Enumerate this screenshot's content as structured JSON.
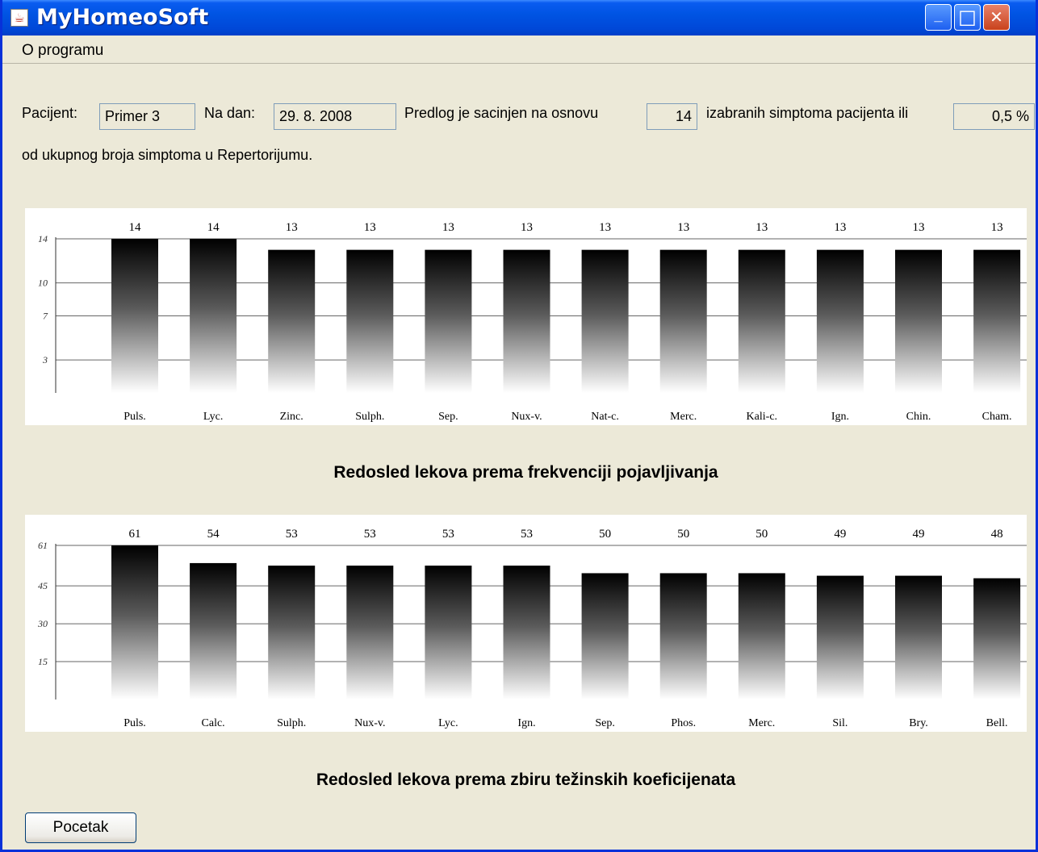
{
  "window": {
    "title": "MyHomeoSoft",
    "minimize_glyph": "_",
    "maximize_glyph": "□",
    "close_glyph": "✕"
  },
  "menu": {
    "items": [
      "O programu"
    ]
  },
  "patient": {
    "patient_label": "Pacijent:",
    "patient_value": "Primer 3",
    "date_label": "Na dan:",
    "date_value": "29. 8. 2008",
    "basis_label": "Predlog je sacinjen na osnovu",
    "symptom_count": "14",
    "selected_label": "izabranih simptoma pacijenta ili",
    "percent_value": "0,5 %",
    "total_label": "od ukupnog broja simptoma u Repertorijumu."
  },
  "chart_data": [
    {
      "type": "bar",
      "title": "Redosled lekova prema frekvenciji pojavljivanja",
      "categories": [
        "Puls.",
        "Lyc.",
        "Zinc.",
        "Sulph.",
        "Sep.",
        "Nux-v.",
        "Nat-c.",
        "Merc.",
        "Kali-c.",
        "Ign.",
        "Chin.",
        "Cham."
      ],
      "values": [
        14,
        14,
        13,
        13,
        13,
        13,
        13,
        13,
        13,
        13,
        13,
        13
      ],
      "yticks": [
        3,
        7,
        10,
        14
      ],
      "ylim": [
        0,
        14
      ],
      "grid": true
    },
    {
      "type": "bar",
      "title": "Redosled lekova prema zbiru težinskih koeficijenata",
      "categories": [
        "Puls.",
        "Calc.",
        "Sulph.",
        "Nux-v.",
        "Lyc.",
        "Ign.",
        "Sep.",
        "Phos.",
        "Merc.",
        "Sil.",
        "Bry.",
        "Bell."
      ],
      "values": [
        61,
        54,
        53,
        53,
        53,
        53,
        50,
        50,
        50,
        49,
        49,
        48
      ],
      "yticks": [
        15,
        30,
        45,
        61
      ],
      "ylim": [
        0,
        61
      ],
      "grid": true
    }
  ],
  "buttons": {
    "start_label": "Pocetak"
  }
}
